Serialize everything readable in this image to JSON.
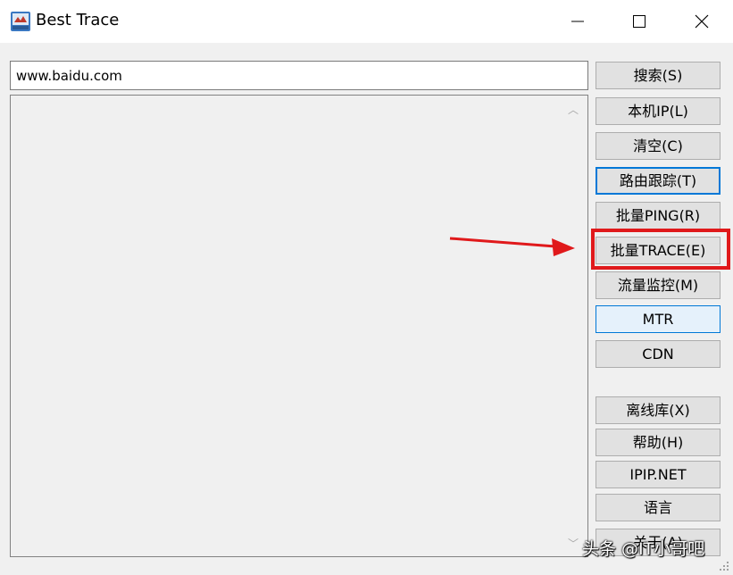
{
  "window": {
    "title": "Best Trace",
    "icon": "best-trace-app-icon",
    "controls": [
      "minimize-icon",
      "maximize-icon",
      "close-icon"
    ]
  },
  "url_input": {
    "value": "www.baidu.com"
  },
  "buttons": [
    {
      "label": "搜索(S)"
    },
    {
      "label": "本机IP(L)"
    },
    {
      "label": "清空(C)"
    },
    {
      "label": "路由跟踪(T)"
    },
    {
      "label": "批量PING(R)"
    },
    {
      "label": "批量TRACE(E)"
    },
    {
      "label": "流量监控(M)"
    },
    {
      "label": "MTR"
    },
    {
      "label": "CDN"
    },
    {
      "label": "离线库(X)"
    },
    {
      "label": "帮助(H)"
    },
    {
      "label": "IPIP.NET"
    },
    {
      "label": "语言"
    },
    {
      "label": "关于(A)"
    }
  ],
  "annotation": {
    "color": "#e0191b",
    "target": "批量TRACE(E)"
  },
  "watermark": "头条 @IT小哥吧",
  "colors": {
    "accent": "#0078d7",
    "highlight": "#e0191b"
  }
}
